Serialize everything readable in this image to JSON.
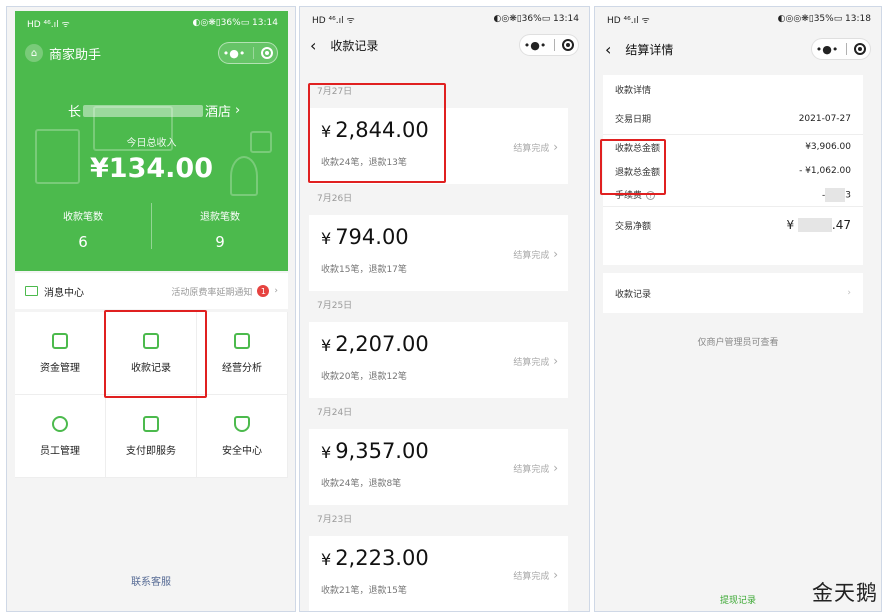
{
  "status": {
    "left": "HD ⁴⁶.ıl ᯤ",
    "p1_right": "◐◎❋▯36%▭ 13:14",
    "p2_right": "◐◎❋▯36%▭ 13:14",
    "p3_right": "◐◎◎❋▯35%▭ 13:18"
  },
  "p1": {
    "app_title": "商家助手",
    "store_prefix": "长",
    "store_suffix": "酒店",
    "today_label": "今日总收入",
    "today_amount": "¥134.00",
    "receipts_label": "收款笔数",
    "receipts_count": "6",
    "refunds_label": "退款笔数",
    "refunds_count": "9",
    "msg_center": "消息中心",
    "msg_notice": "活动原费率延期通知",
    "msg_badge": "1",
    "grid": [
      "资金管理",
      "收款记录",
      "经营分析",
      "员工管理",
      "支付即服务",
      "安全中心"
    ],
    "support": "联系客服"
  },
  "p2": {
    "title": "收款记录",
    "records": [
      {
        "date": "7月27日",
        "amount": "2,844.00",
        "detail": "收款24笔，退款13笔",
        "status": "结算完成"
      },
      {
        "date": "7月26日",
        "amount": "794.00",
        "detail": "收款15笔，退款17笔",
        "status": "结算完成"
      },
      {
        "date": "7月25日",
        "amount": "2,207.00",
        "detail": "收款20笔，退款12笔",
        "status": "结算完成"
      },
      {
        "date": "7月24日",
        "amount": "9,357.00",
        "detail": "收款24笔，退款8笔",
        "status": "结算完成"
      },
      {
        "date": "7月23日",
        "amount": "2,223.00",
        "detail": "收款21笔，退款15笔",
        "status": "结算完成"
      }
    ],
    "currency": "¥"
  },
  "p3": {
    "title": "结算详情",
    "section": "收款详情",
    "trade_date_label": "交易日期",
    "trade_date": "2021-07-27",
    "total_in_label": "收款总金额",
    "total_in": "¥3,906.00",
    "total_refund_label": "退款总金额",
    "total_refund": "- ¥1,062.00",
    "fee_label": "手续费",
    "fee_value": "-",
    "fee_value_end": "3",
    "net_label": "交易净额",
    "net_prefix": "¥",
    "net_suffix": ".47",
    "records_link": "收款记录",
    "admin_note": "仅商户管理员可查看",
    "withdraw_link": "提现记录"
  },
  "watermark": "金天鹅"
}
